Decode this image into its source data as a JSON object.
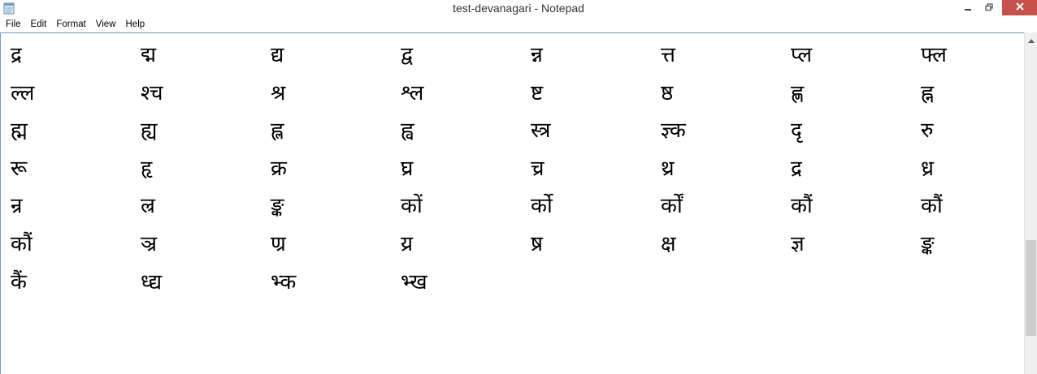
{
  "window": {
    "title": "test-devanagari - Notepad"
  },
  "titlebar": {
    "icon": "notepad-icon",
    "buttons": {
      "minimize_icon": "minimize-icon",
      "maximize_icon": "restore-icon",
      "close_icon": "close-icon",
      "close_color": "#c7504b"
    }
  },
  "menubar": {
    "items": [
      {
        "label": "File"
      },
      {
        "label": "Edit"
      },
      {
        "label": "Format"
      },
      {
        "label": "View"
      },
      {
        "label": "Help"
      }
    ]
  },
  "editor": {
    "rows": [
      [
        "द्र",
        "द्म",
        "द्य",
        "द्व",
        "न्न",
        "त्त",
        "प्ल",
        "फ्ल"
      ],
      [
        "ल्ल",
        "श्च",
        "श्र",
        "श्ल",
        "ष्ट",
        "ष्ठ",
        "ह्ण",
        "ह्न"
      ],
      [
        "ह्म",
        "ह्य",
        "ह्ल",
        "ह्व",
        "स्त्र",
        "ज्ञ्क",
        "दृ",
        "रु"
      ],
      [
        "रू",
        "हृ",
        "क्र",
        "घ्र",
        "च्र",
        "थ्र",
        "द्र",
        "ध्र"
      ],
      [
        "न्र",
        "ल्र",
        "ङ्क",
        "कों",
        "र्को",
        "र्कों",
        "कौं",
        "कौं"
      ],
      [
        "कौं",
        "ञ्र",
        "ण्र",
        "य्र",
        "ष्र",
        "क्ष",
        "ज्ञ",
        "ङ्क"
      ],
      [
        "कैं",
        "ध्द्य",
        "भ्क",
        "भ्ख"
      ]
    ]
  },
  "colors": {
    "border_accent": "#6ca0cc",
    "scrollbar_track": "#f0f0f0",
    "scrollbar_thumb": "#cdcdcd"
  }
}
